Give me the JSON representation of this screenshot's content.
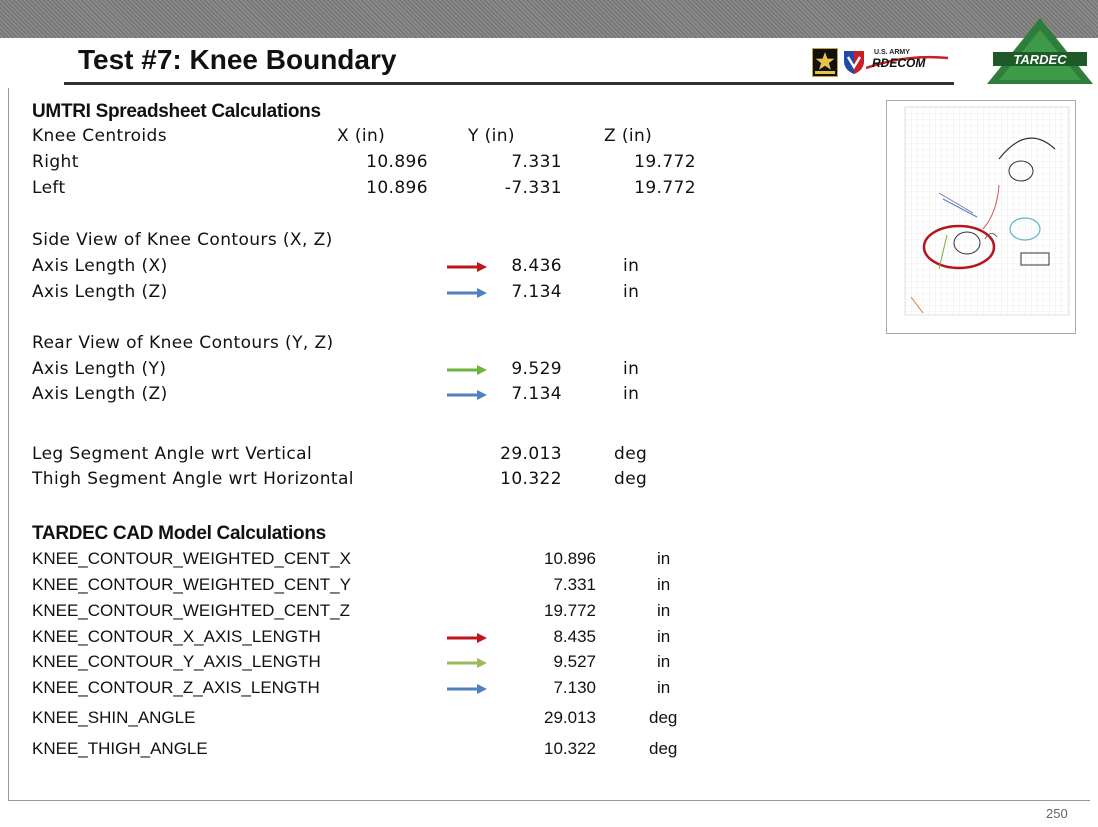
{
  "header": {
    "title": "Test #7: Knee Boundary",
    "logos": {
      "army_icon": "army-star-logo",
      "rdecom_small": "U.S. ARMY",
      "rdecom_big": "RDECOM",
      "tardec": "TARDEC"
    }
  },
  "umtri": {
    "heading": "UMTRI Spreadsheet Calculations",
    "centroids": {
      "label": "Knee Centroids",
      "cols": [
        "X (in)",
        "Y (in)",
        "Z (in)"
      ],
      "rows": [
        {
          "label": "Right",
          "x": "10.896",
          "y": "7.331",
          "z": "19.772"
        },
        {
          "label": "Left",
          "x": "10.896",
          "y": "-7.331",
          "z": "19.772"
        }
      ]
    },
    "side_view": {
      "label": "Side View of Knee Contours (X, Z)",
      "rows": [
        {
          "label": "Axis Length (X)",
          "value": "8.436",
          "unit": "in",
          "arrow_color": "#c0161b"
        },
        {
          "label": "Axis Length (Z)",
          "value": "7.134",
          "unit": "in",
          "arrow_color": "#4f81bd"
        }
      ]
    },
    "rear_view": {
      "label": "Rear View of Knee Contours (Y, Z)",
      "rows": [
        {
          "label": "Axis Length (Y)",
          "value": "9.529",
          "unit": "in",
          "arrow_color": "#6db33f"
        },
        {
          "label": "Axis Length (Z)",
          "value": "7.134",
          "unit": "in",
          "arrow_color": "#4f81bd"
        }
      ]
    },
    "angles": [
      {
        "label": "Leg Segment Angle wrt Vertical",
        "value": "29.013",
        "unit": "deg"
      },
      {
        "label": "Thigh Segment Angle wrt Horizontal",
        "value": "10.322",
        "unit": "deg"
      }
    ]
  },
  "tardec": {
    "heading": "TARDEC CAD Model Calculations",
    "rows": [
      {
        "label": "KNEE_CONTOUR_WEIGHTED_CENT_X",
        "value": "10.896",
        "unit": "in"
      },
      {
        "label": "KNEE_CONTOUR_WEIGHTED_CENT_Y",
        "value": "7.331",
        "unit": "in"
      },
      {
        "label": "KNEE_CONTOUR_WEIGHTED_CENT_Z",
        "value": "19.772",
        "unit": "in"
      },
      {
        "label": "KNEE_CONTOUR_X_AXIS_LENGTH",
        "value": "8.435",
        "unit": "in",
        "arrow_color": "#c0161b"
      },
      {
        "label": "KNEE_CONTOUR_Y_AXIS_LENGTH",
        "value": "9.527",
        "unit": "in",
        "arrow_color": "#9bbb59"
      },
      {
        "label": "KNEE_CONTOUR_Z_AXIS_LENGTH",
        "value": "7.130",
        "unit": "in",
        "arrow_color": "#4f81bd"
      },
      {
        "label": "KNEE_SHIN_ANGLE",
        "value": "29.013",
        "unit": "deg"
      },
      {
        "label": "KNEE_THIGH_ANGLE",
        "value": "10.322",
        "unit": "deg"
      }
    ]
  },
  "thumbnail": {
    "icon": "knee-contour-plot-thumbnail",
    "highlight_color": "#b3171c"
  },
  "footer": {
    "page_number": "250"
  }
}
